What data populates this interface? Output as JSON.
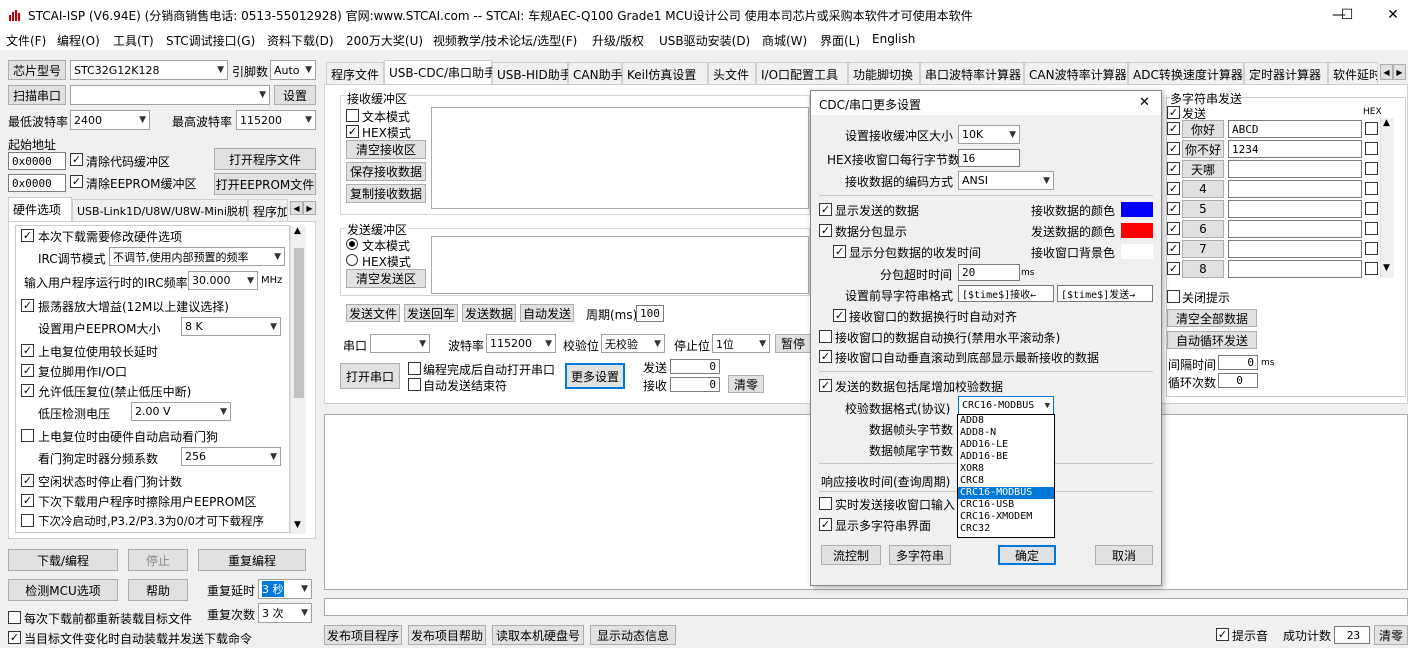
{
  "window": {
    "title": "STCAI-ISP (V6.94E) (分销商销售电话: 0513-55012928) 官网:www.STCAI.com  -- STCAI: 车规AEC-Q100 Grade1 MCU设计公司 使用本司芯片或采购本软件才可使用本软件",
    "minimize": "—",
    "maximize": "☐",
    "close": "✕"
  },
  "menu": [
    "文件(F)",
    "编程(O)",
    "工具(T)",
    "STC调试接口(G)",
    "资料下载(D)",
    "200万大奖(U)",
    "视频教学/技术论坛/选型(F)",
    "升级/版权",
    "USB驱动安装(D)",
    "商城(W)",
    "界面(L)",
    "English"
  ],
  "left": {
    "chip_btn": "芯片型号",
    "chip_value": "STC32G12K128",
    "engine_label": "引脚数",
    "engine_value": "Auto",
    "scan_btn": "扫描串口",
    "port_value": "",
    "settings_btn": "设置",
    "min_baud_label": "最低波特率",
    "min_baud": "2400",
    "max_baud_label": "最高波特率",
    "max_baud": "115200",
    "start_addr_label": "起始地址",
    "addr1": "0x0000",
    "clear_code": "清除代码缓冲区",
    "open_prog": "打开程序文件",
    "addr2": "0x0000",
    "clear_eeprom": "清除EEPROM缓冲区",
    "open_eeprom": "打开EEPROM文件",
    "tabs": [
      "硬件选项",
      "USB-Link1D/U8W/U8W-Mini脱机",
      "程序加"
    ],
    "hw": {
      "o1": "本次下载需要修改硬件选项",
      "irc_label": "IRC调节模式",
      "irc_value": "不调节,使用内部预置的频率",
      "freq_label": "输入用户程序运行时的IRC频率",
      "freq_value": "30.000",
      "freq_unit": "MHz",
      "o2": "振荡器放大增益(12M以上建议选择)",
      "eeprom_label": "设置用户EEPROM大小",
      "eeprom_value": "8  K",
      "o3": "上电复位使用较长延时",
      "o4": "复位脚用作I/O口",
      "o5": "允许低压复位(禁止低压中断)",
      "lv_label": "低压检测电压",
      "lv_value": "2.00 V",
      "o6": "上电复位时由硬件自动启动看门狗",
      "wdt_label": "看门狗定时器分频系数",
      "wdt_value": "256",
      "o7": "空闲状态时停止看门狗计数",
      "o8": "下次下载用户程序时擦除用户EEPROM区",
      "o9": "下次冷启动时,P3.2/P3.3为0/0才可下载程序"
    },
    "download_btn": "下载/编程",
    "stop_btn": "停止",
    "reprogram_btn": "重复编程",
    "check_mcu_btn": "检测MCU选项",
    "help_btn": "帮助",
    "repeat_delay_label": "重复延时",
    "repeat_delay": "3 秒",
    "repeat_count_label": "重复次数",
    "repeat_count": "3 次",
    "reload_each": "每次下载前都重新装载目标文件",
    "auto_send": "当目标文件变化时自动装载并发送下载命令"
  },
  "tabs": [
    "程序文件",
    "USB-CDC/串口助手",
    "USB-HID助手",
    "CAN助手",
    "Keil仿真设置",
    "头文件",
    "I/O口配置工具",
    "功能脚切换",
    "串口波特率计算器",
    "CAN波特率计算器",
    "ADC转换速度计算器",
    "定时器计算器",
    "软件延时"
  ],
  "assistant": {
    "recv_title": "接收缓冲区",
    "text_mode": "文本模式",
    "hex_mode": "HEX模式",
    "clear_recv": "清空接收区",
    "save_recv": "保存接收数据",
    "copy_recv": "复制接收数据",
    "send_title": "发送缓冲区",
    "s_text": "文本模式",
    "s_hex": "HEX模式",
    "clear_send": "清空发送区",
    "send_file": "发送文件",
    "send_enter": "发送回车",
    "send_data": "发送数据",
    "auto_send": "自动发送",
    "period_label": "周期(ms)",
    "period": "100",
    "port_label": "串口",
    "baud_label": "波特率",
    "baud": "115200",
    "parity_label": "校验位",
    "parity": "无校验",
    "stop_label": "停止位",
    "stop": "1位",
    "pause": "暂停",
    "open_port": "打开串口",
    "auto_open": "编程完成后自动打开串口",
    "auto_end": "自动发送结束符",
    "more": "更多设置",
    "tx_label": "发送",
    "tx": "0",
    "rx_label": "接收",
    "rx": "0",
    "clear": "清零"
  },
  "multi": {
    "title": "多字符串发送",
    "send_label": "发送",
    "hex_label": "HEX",
    "rows": [
      {
        "name": "你好",
        "value": "ABCD"
      },
      {
        "name": "你不好",
        "value": "1234"
      },
      {
        "name": "天哪",
        "value": ""
      },
      {
        "name": "4",
        "value": ""
      },
      {
        "name": "5",
        "value": ""
      },
      {
        "name": "6",
        "value": ""
      },
      {
        "name": "7",
        "value": ""
      },
      {
        "name": "8",
        "value": ""
      }
    ],
    "close_hint": "关闭提示",
    "clear_all": "清空全部数据",
    "auto_loop": "自动循环发送",
    "interval_label": "间隔时间",
    "interval": "0",
    "interval_unit": "ms",
    "loop_label": "循环次数",
    "loop": "0"
  },
  "dialog": {
    "title": "CDC/串口更多设置",
    "close": "✕",
    "buf_label": "设置接收缓冲区大小",
    "buf": "10K",
    "hex_bytes_label": "HEX接收窗口每行字节数",
    "hex_bytes": "16",
    "enc_label": "接收数据的编码方式",
    "enc": "ANSI",
    "show_sent": "显示发送的数据",
    "recv_color_label": "接收数据的颜色",
    "split_show": "数据分包显示",
    "send_color_label": "发送数据的颜色",
    "show_time": "显示分包数据的收发时间",
    "bg_label": "接收窗口背景色",
    "timeout_label": "分包超时时间",
    "timeout": "20",
    "timeout_unit": "ms",
    "prefix_label": "设置前导字符串格式",
    "prefix_recv": "[$time$]接收←",
    "prefix_send": "[$time$]发送→",
    "align": "接收窗口的数据换行时自动对齐",
    "autowrap": "接收窗口的数据自动换行(禁用水平滚动条)",
    "autoscroll": "接收窗口自动垂直滚动到底部显示最新接收的数据",
    "checksum": "发送的数据包括尾增加校验数据",
    "fmt_label": "校验数据格式(协议)",
    "fmt": "CRC16-MODBUS",
    "head_label": "数据帧头字节数",
    "tail_label": "数据帧尾字节数",
    "resp_label": "响应接收时间(查询周期)",
    "realtime": "实时发送接收窗口输入",
    "show_multi": "显示多字符串界面",
    "flow_btn": "流控制",
    "multi_btn": "多字符串",
    "ok": "确定",
    "cancel": "取消",
    "options": [
      "ADD8",
      "ADD8-N",
      "ADD16-LE",
      "ADD16-BE",
      "XOR8",
      "CRC8",
      "CRC16-MODBUS",
      "CRC16-USB",
      "CRC16-XMODEM",
      "CRC32"
    ],
    "colors": {
      "recv": "#0000ff",
      "send": "#ff0000",
      "bg": "#ffffff"
    }
  },
  "bottom": {
    "publish": "发布项目程序",
    "publish_help": "发布项目帮助",
    "read_disk": "读取本机硬盘号",
    "show_anim": "显示动态信息",
    "beep": "提示音",
    "success_label": "成功计数",
    "success": "23",
    "clear": "清零"
  }
}
